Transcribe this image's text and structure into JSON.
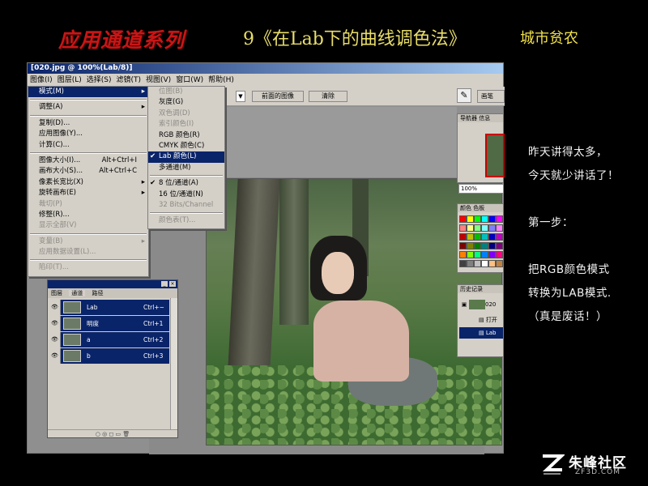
{
  "header": {
    "series_title": "应用通道系列",
    "lesson_title": "9《在Lab下的曲线调色法》",
    "author": "城市贫农"
  },
  "app": {
    "window_title": "[020.jpg @ 100%(Lab/8)]",
    "menubar": [
      "图像(I)",
      "图层(L)",
      "选择(S)",
      "滤镜(T)",
      "视图(V)",
      "窗口(W)",
      "帮助(H)"
    ],
    "option_buttons": [
      "前面的图像",
      "清除"
    ],
    "image_menu": {
      "items": [
        {
          "label": "模式(M)",
          "shortcut": "",
          "submenu": true,
          "selected": true,
          "disabled": false
        },
        {
          "sep": true
        },
        {
          "label": "调整(A)",
          "shortcut": "",
          "submenu": true,
          "selected": false,
          "disabled": false
        },
        {
          "sep": true
        },
        {
          "label": "复制(D)...",
          "shortcut": "",
          "submenu": false,
          "selected": false,
          "disabled": false
        },
        {
          "label": "应用图像(Y)...",
          "shortcut": "",
          "submenu": false,
          "selected": false,
          "disabled": false
        },
        {
          "label": "计算(C)...",
          "shortcut": "",
          "submenu": false,
          "selected": false,
          "disabled": false
        },
        {
          "sep": true
        },
        {
          "label": "图像大小(I)...",
          "shortcut": "Alt+Ctrl+I",
          "submenu": false,
          "selected": false,
          "disabled": false
        },
        {
          "label": "画布大小(S)...",
          "shortcut": "Alt+Ctrl+C",
          "submenu": false,
          "selected": false,
          "disabled": false
        },
        {
          "label": "像素长宽比(X)",
          "shortcut": "",
          "submenu": true,
          "selected": false,
          "disabled": false
        },
        {
          "label": "旋转画布(E)",
          "shortcut": "",
          "submenu": true,
          "selected": false,
          "disabled": false
        },
        {
          "label": "裁切(P)",
          "shortcut": "",
          "submenu": false,
          "selected": false,
          "disabled": true
        },
        {
          "label": "修整(R)...",
          "shortcut": "",
          "submenu": false,
          "selected": false,
          "disabled": false
        },
        {
          "label": "显示全部(V)",
          "shortcut": "",
          "submenu": false,
          "selected": false,
          "disabled": true
        },
        {
          "sep": true
        },
        {
          "label": "变量(B)",
          "shortcut": "",
          "submenu": true,
          "selected": false,
          "disabled": true
        },
        {
          "label": "应用数据设置(L)...",
          "shortcut": "",
          "submenu": false,
          "selected": false,
          "disabled": true
        },
        {
          "sep": true
        },
        {
          "label": "陷印(T)...",
          "shortcut": "",
          "submenu": false,
          "selected": false,
          "disabled": true
        }
      ]
    },
    "mode_submenu": {
      "items": [
        {
          "label": "位图(B)",
          "checked": false,
          "selected": false,
          "disabled": true
        },
        {
          "label": "灰度(G)",
          "checked": false,
          "selected": false,
          "disabled": false
        },
        {
          "label": "双色调(D)",
          "checked": false,
          "selected": false,
          "disabled": true
        },
        {
          "label": "索引颜色(I)",
          "checked": false,
          "selected": false,
          "disabled": true
        },
        {
          "label": "RGB 颜色(R)",
          "checked": false,
          "selected": false,
          "disabled": false
        },
        {
          "label": "CMYK 颜色(C)",
          "checked": false,
          "selected": false,
          "disabled": false
        },
        {
          "label": "Lab 颜色(L)",
          "checked": true,
          "selected": true,
          "disabled": false
        },
        {
          "label": "多通道(M)",
          "checked": false,
          "selected": false,
          "disabled": false
        },
        {
          "sep": true
        },
        {
          "label": "8 位/通道(A)",
          "checked": true,
          "selected": false,
          "disabled": false
        },
        {
          "label": "16 位/通道(N)",
          "checked": false,
          "selected": false,
          "disabled": false
        },
        {
          "label": "32 Bits/Channel",
          "checked": false,
          "selected": false,
          "disabled": true
        },
        {
          "sep": true
        },
        {
          "label": "颜色表(T)...",
          "checked": false,
          "selected": false,
          "disabled": true
        }
      ]
    },
    "channels_palette": {
      "tabs": [
        "图层",
        "通道",
        "路径"
      ],
      "rows": [
        {
          "name": "Lab",
          "shortcut": "Ctrl+~"
        },
        {
          "name": "明度",
          "shortcut": "Ctrl+1"
        },
        {
          "name": "a",
          "shortcut": "Ctrl+2"
        },
        {
          "name": "b",
          "shortcut": "Ctrl+3"
        }
      ]
    },
    "navigator": {
      "tabs": [
        "导航器",
        "信息"
      ],
      "zoom": "100%"
    },
    "swatches": {
      "tabs": [
        "颜色",
        "色板"
      ]
    },
    "history": {
      "tabs": [
        "历史记录"
      ],
      "rows": [
        "020",
        "打开",
        "Lab"
      ]
    },
    "toolbar_right": {
      "brushes_tab": "画笔"
    }
  },
  "notes": {
    "lines": [
      "昨天讲得太多，",
      "今天就少讲话了！",
      "第一步：",
      "把RGB颜色模式",
      "转换为LAB模式.",
      "（真是废话！）"
    ]
  },
  "logo": {
    "name": "朱峰社区",
    "url_text": "ZF3D.COM"
  },
  "colors": {
    "title_red": "#c81616",
    "lesson_yellow": "#e8dd6a",
    "menu_highlight": "#0a246a",
    "panel_gray": "#d4d0c8"
  }
}
